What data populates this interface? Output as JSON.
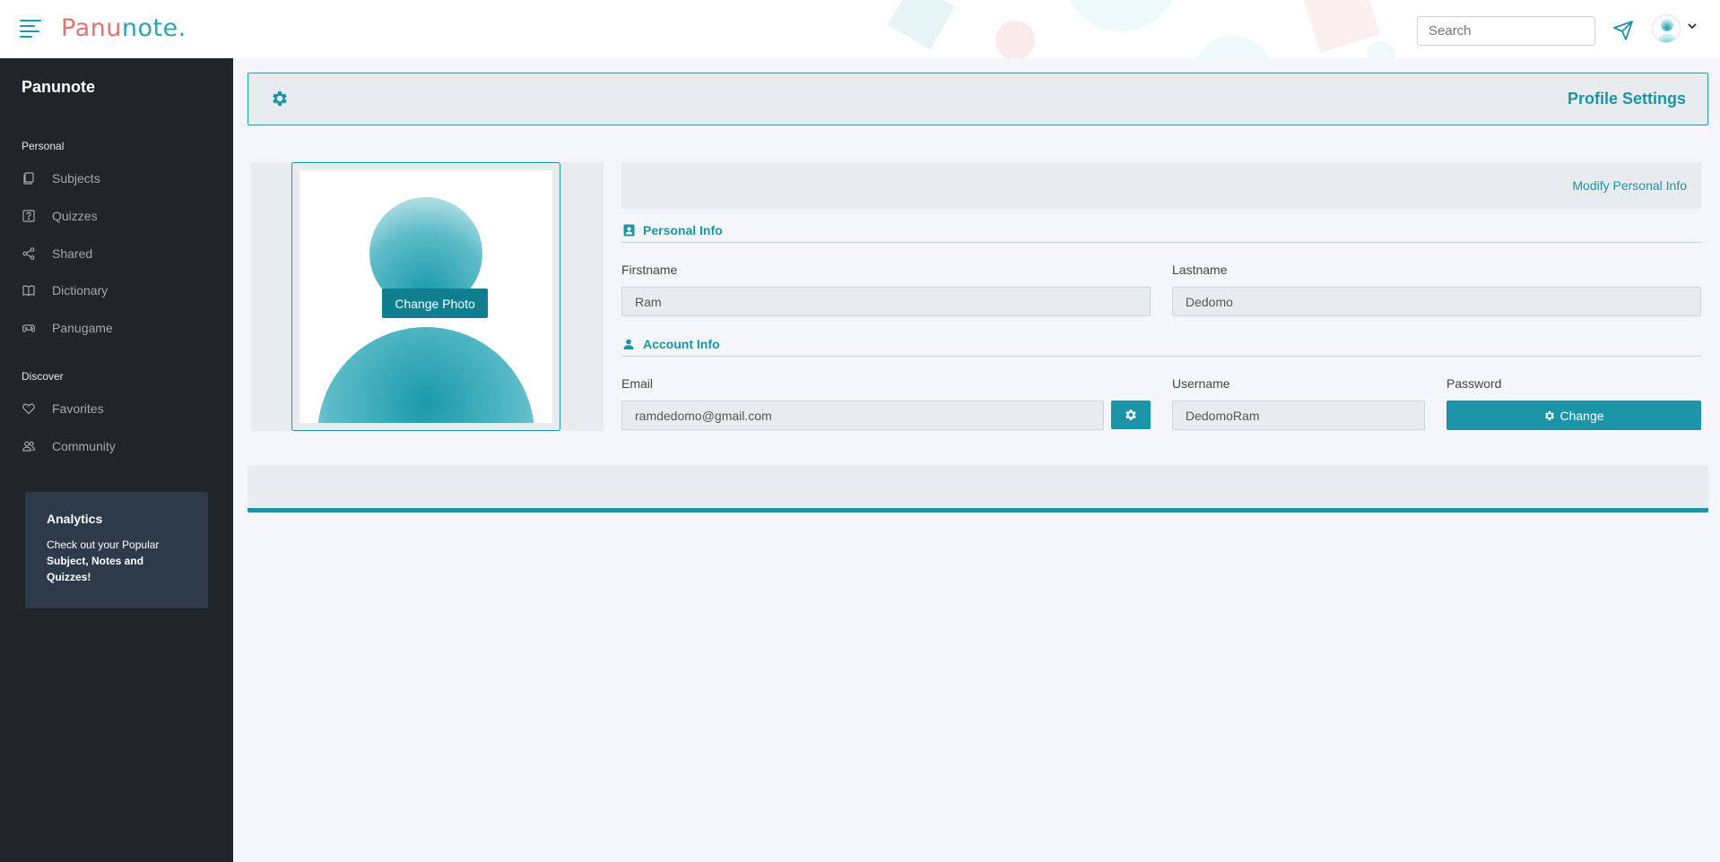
{
  "topbar": {
    "logo_first": "Panu",
    "logo_second": "note.",
    "search_placeholder": "Search",
    "menu_icon": "hamburger-icon",
    "send_icon": "paper-plane-icon",
    "avatar_icon": "user-avatar-icon",
    "dropdown_icon": "chevron-down-icon"
  },
  "sidebar": {
    "brand": "Panunote",
    "sections": [
      {
        "title": "Personal",
        "items": [
          {
            "label": "Subjects",
            "icon": "copy-icon"
          },
          {
            "label": "Quizzes",
            "icon": "question-square-icon"
          },
          {
            "label": "Shared",
            "icon": "share-icon"
          },
          {
            "label": "Dictionary",
            "icon": "book-icon"
          },
          {
            "label": "Panugame",
            "icon": "gamepad-icon"
          }
        ]
      },
      {
        "title": "Discover",
        "items": [
          {
            "label": "Favorites",
            "icon": "heart-icon"
          },
          {
            "label": "Community",
            "icon": "people-icon"
          }
        ]
      }
    ],
    "promo": {
      "title": "Analytics",
      "text_plain": "Check out your Popular ",
      "text_bold": "Subject, Notes and Quizzes!"
    }
  },
  "header": {
    "title": "Profile Settings",
    "icon": "gear-icon"
  },
  "photo": {
    "change_label": "Change Photo"
  },
  "profile": {
    "modify_label": "Modify Personal Info",
    "personal_section": "Personal Info",
    "personal_icon": "contact-card-icon",
    "firstname_label": "Firstname",
    "firstname_value": "Ram",
    "lastname_label": "Lastname",
    "lastname_value": "Dedomo",
    "account_section": "Account Info",
    "account_icon": "person-icon",
    "email_label": "Email",
    "email_value": "ramdedomo@gmail.com",
    "username_label": "Username",
    "username_value": "DedomoRam",
    "password_label": "Password",
    "change_label": "Change"
  },
  "colors": {
    "accent": "#1a94a6",
    "sidebar_bg": "#212529",
    "promo_bg": "#2c3a4a",
    "page_bg": "#f4f6fa",
    "panel_bg": "#e9ecef"
  }
}
